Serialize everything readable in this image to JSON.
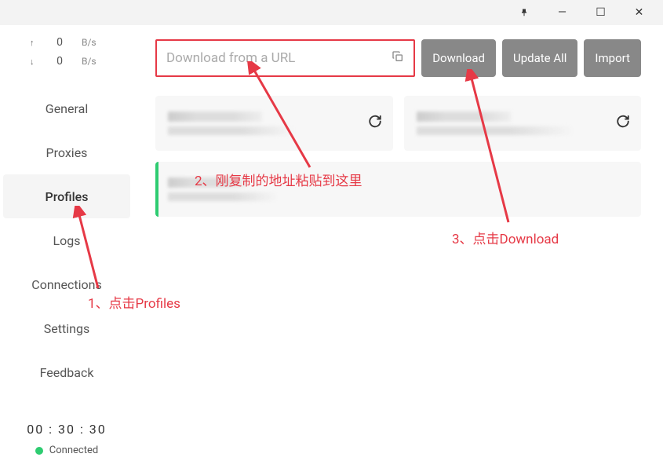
{
  "titlebar": {
    "pin": "📍",
    "minimize": "—",
    "maximize": "☐",
    "close": "✕"
  },
  "sidebar": {
    "speed": {
      "up_arrow": "↑",
      "up_value": "0",
      "up_unit": "B/s",
      "down_arrow": "↓",
      "down_value": "0",
      "down_unit": "B/s"
    },
    "nav": [
      {
        "label": "General",
        "active": false
      },
      {
        "label": "Proxies",
        "active": false
      },
      {
        "label": "Profiles",
        "active": true
      },
      {
        "label": "Logs",
        "active": false
      },
      {
        "label": "Connections",
        "active": false
      },
      {
        "label": "Settings",
        "active": false
      },
      {
        "label": "Feedback",
        "active": false
      }
    ],
    "timer": "00 : 30 : 30",
    "status": {
      "text": "Connected",
      "color": "#2ecc71"
    }
  },
  "content": {
    "url_placeholder": "Download from a URL",
    "buttons": {
      "download": "Download",
      "update_all": "Update All",
      "import": "Import"
    },
    "profiles": [
      {
        "subtitle_hint": "cloud (8 hours)"
      },
      {
        "subtitle_hint": "hours)"
      }
    ]
  },
  "annotations": {
    "step1": "1、点击Profiles",
    "step2": "2、刚复制的地址粘贴到这里",
    "step3": "3、点击Download"
  }
}
